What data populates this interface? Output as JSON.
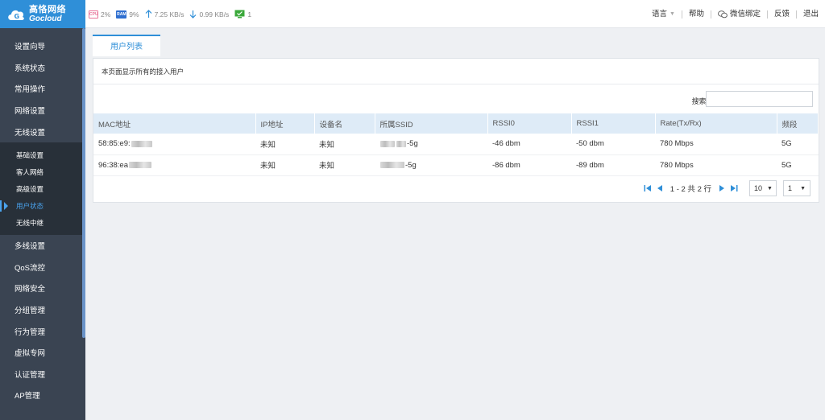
{
  "brand": {
    "name_cn": "高恪网络",
    "name_en": "Gocloud"
  },
  "stats": {
    "cpu_label": "CPU",
    "cpu": "2%",
    "ram_label": "RAM",
    "ram": "9%",
    "upload": "7.25 KB/s",
    "download": "0.99 KB/s",
    "connected": "1"
  },
  "toplinks": {
    "language": "语言",
    "help": "帮助",
    "wechat": "微信绑定",
    "feedback": "反馈",
    "logout": "退出"
  },
  "sidebar": {
    "items_top": [
      "设置向导",
      "系统状态",
      "常用操作",
      "网络设置",
      "无线设置"
    ],
    "sub_items": [
      "基础设置",
      "客人网络",
      "高级设置",
      "用户状态",
      "无线中继"
    ],
    "items_bottom": [
      "多线设置",
      "QoS流控",
      "网络安全",
      "分组管理",
      "行为管理",
      "虚拟专网",
      "认证管理",
      "AP管理"
    ]
  },
  "tab": {
    "label": "用户列表"
  },
  "panel": {
    "description": "本页面显示所有的接入用户",
    "search_label": "搜索:",
    "search_value": ""
  },
  "table": {
    "headers": [
      "MAC地址",
      "IP地址",
      "设备名",
      "所属SSID",
      "RSSI0",
      "RSSI1",
      "Rate(Tx/Rx)",
      "频段"
    ],
    "rows": [
      {
        "mac": "58:85:e9:",
        "ip": "未知",
        "device": "未知",
        "ssid": "-5g",
        "rssi0": "-46 dbm",
        "rssi1": "-50 dbm",
        "rate": "780 Mbps",
        "band": "5G"
      },
      {
        "mac": "96:38:ea",
        "ip": "未知",
        "device": "未知",
        "ssid": "-5g",
        "rssi0": "-86 dbm",
        "rssi1": "-89 dbm",
        "rate": "780 Mbps",
        "band": "5G"
      }
    ]
  },
  "pager": {
    "info": "1 - 2 共 2 行",
    "page_size": "10",
    "page": "1"
  },
  "colors": {
    "accent": "#2f8fd8",
    "sidebar": "#3a4452",
    "submenu": "#283039",
    "header_row": "#deebf7"
  }
}
